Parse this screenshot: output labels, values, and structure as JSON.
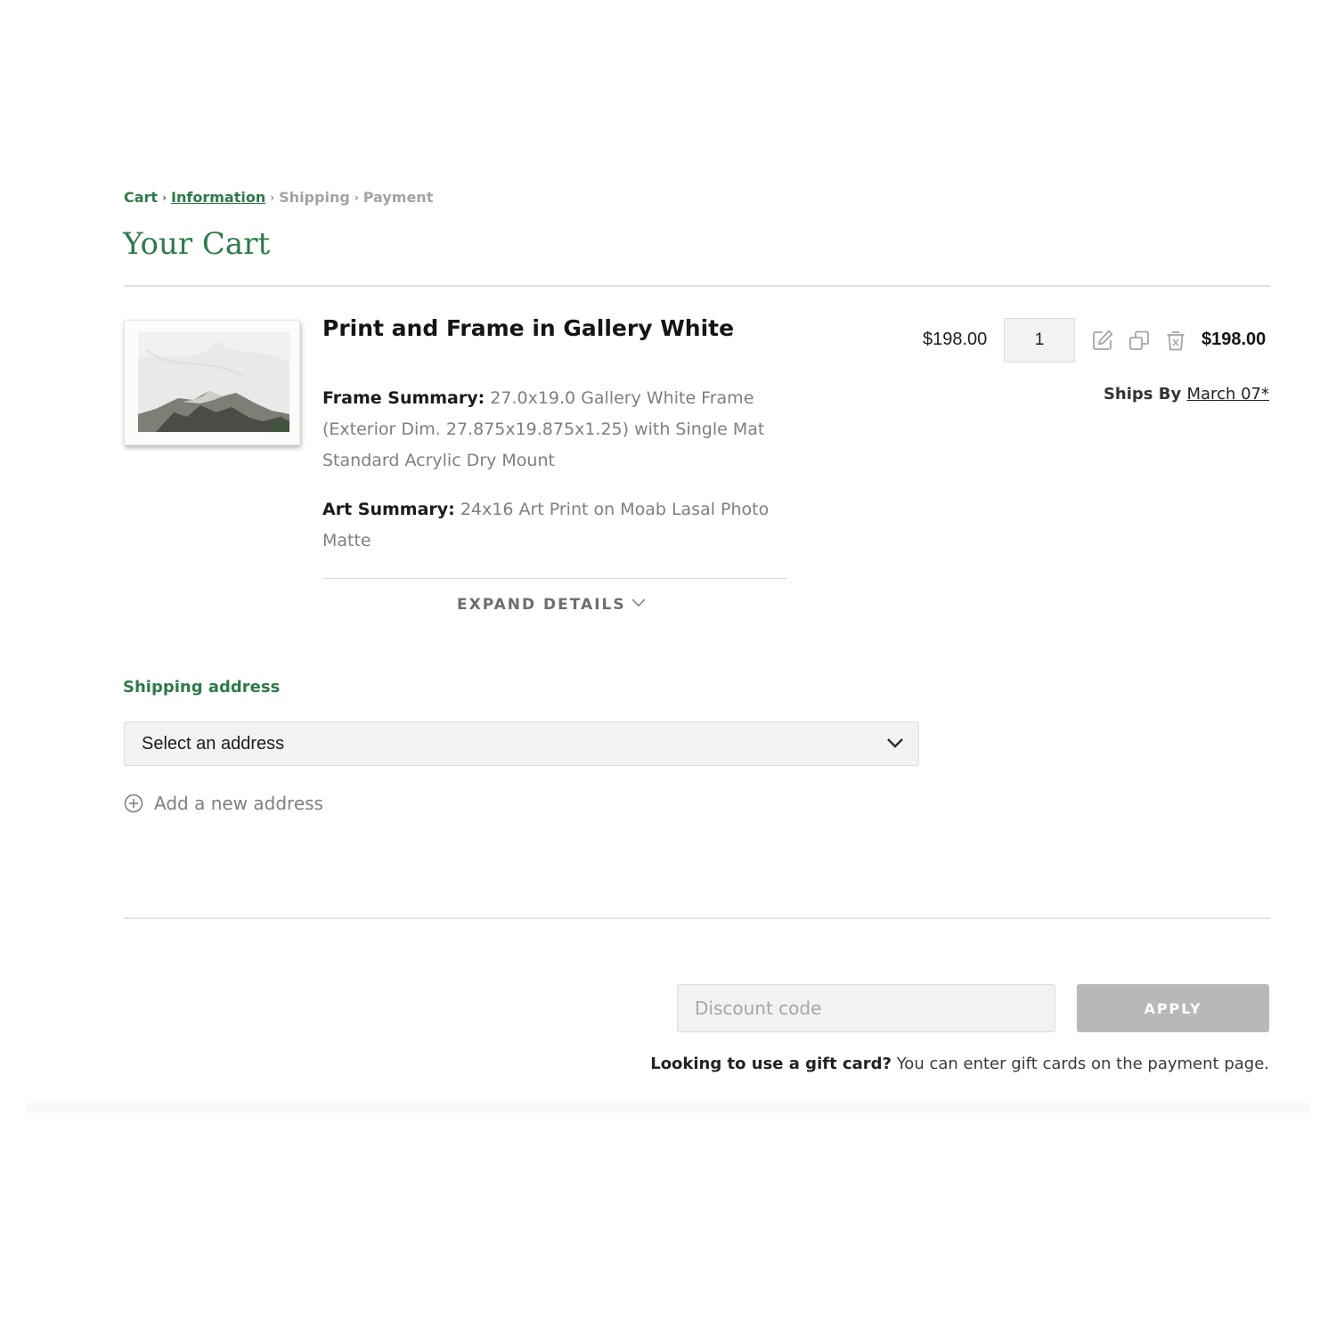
{
  "breadcrumb": {
    "items": [
      "Cart",
      "Information",
      "Shipping",
      "Payment"
    ],
    "separator": "›"
  },
  "page_title": "Your Cart",
  "product": {
    "title": "Print and Frame in Gallery White",
    "frame_summary_label": "Frame Summary:",
    "frame_summary_value": "27.0x19.0 Gallery White Frame (Exterior Dim. 27.875x19.875x1.25) with Single Mat Standard Acrylic Dry Mount",
    "art_summary_label": "Art Summary:",
    "art_summary_value": "24x16 Art Print on Moab Lasal Photo Matte",
    "expand_label": "EXPAND DETAILS",
    "unit_price": "$198.00",
    "quantity": "1",
    "line_total": "$198.00",
    "ships_by_label": "Ships By",
    "ships_by_date": "March 07*",
    "icons": [
      "edit-icon",
      "duplicate-icon",
      "trash-icon"
    ]
  },
  "shipping": {
    "label": "Shipping address",
    "select_value": "Select an address",
    "add_label": "Add a new address"
  },
  "discount": {
    "placeholder": "Discount code",
    "apply_label": "APPLY",
    "gift_bold": "Looking to use a gift card?",
    "gift_text": "You can enter gift cards on the payment page."
  },
  "colors": {
    "brand_green": "#2f7a4c",
    "muted_gray": "#a3a3a3",
    "button_disabled": "#b8b8b8"
  }
}
